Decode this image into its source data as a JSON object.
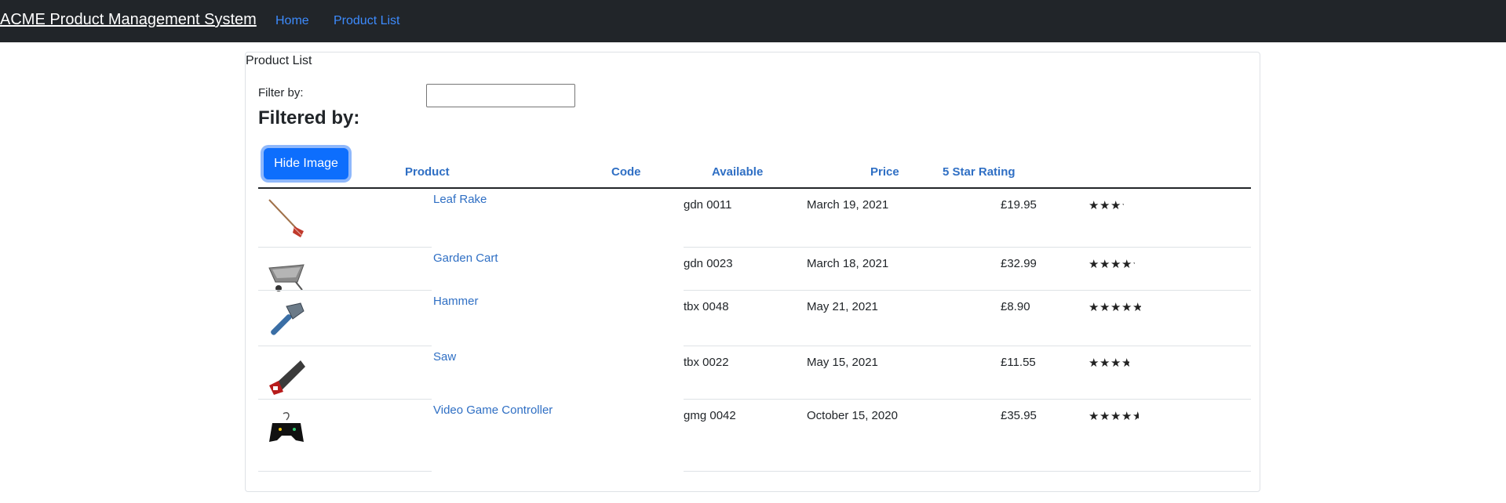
{
  "nav": {
    "brand": "ACME Product Management System",
    "links": [
      "Home",
      "Product List"
    ]
  },
  "card": {
    "header": "Product List",
    "filter_label": "Filter by:",
    "filter_value": "",
    "filtered_by": "Filtered by:"
  },
  "table": {
    "hide_button": "Hide Image",
    "columns": [
      "Product",
      "Code",
      "Available",
      "Price",
      "5 Star Rating"
    ],
    "rows": [
      {
        "name": "Leaf Rake",
        "code": "gdn 0011",
        "available": "March 19, 2021",
        "price": "£19.95",
        "rating": 3.2,
        "image": "leaf-rake"
      },
      {
        "name": "Garden Cart",
        "code": "gdn 0023",
        "available": "March 18, 2021",
        "price": "£32.99",
        "rating": 4.2,
        "image": "garden-cart"
      },
      {
        "name": "Hammer",
        "code": "tbx 0048",
        "available": "May 21, 2021",
        "price": "£8.90",
        "rating": 4.8,
        "image": "hammer"
      },
      {
        "name": "Saw",
        "code": "tbx 0022",
        "available": "May 15, 2021",
        "price": "£11.55",
        "rating": 3.7,
        "image": "saw"
      },
      {
        "name": "Video Game Controller",
        "code": "gmg 0042",
        "available": "October 15, 2020",
        "price": "£35.95",
        "rating": 4.6,
        "image": "video-game-controller"
      }
    ]
  },
  "colors": {
    "navbar_bg": "#212529",
    "link": "#2f6fc4",
    "button": "#0d6efd"
  }
}
